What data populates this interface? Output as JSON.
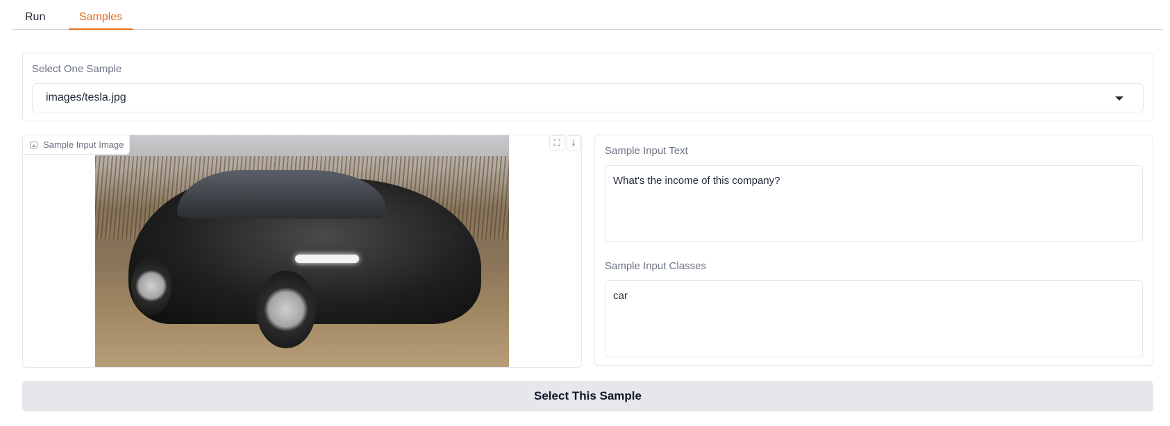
{
  "tabs": [
    {
      "label": "Run",
      "active": false
    },
    {
      "label": "Samples",
      "active": true
    }
  ],
  "colors": {
    "accent": "#ea6a1f",
    "border": "#e5e7eb",
    "button_bg": "#e5e7eb"
  },
  "sample_select": {
    "label": "Select One Sample",
    "value": "images/tesla.jpg"
  },
  "image_panel": {
    "label": "Sample Input Image",
    "icons": [
      "image-icon",
      "fullscreen-icon",
      "download-icon"
    ]
  },
  "text_panel": {
    "input_text_label": "Sample Input Text",
    "input_text_value": "What's the income of this company?",
    "input_classes_label": "Sample Input Classes",
    "input_classes_value": "car"
  },
  "actions": {
    "select_label": "Select This Sample"
  }
}
